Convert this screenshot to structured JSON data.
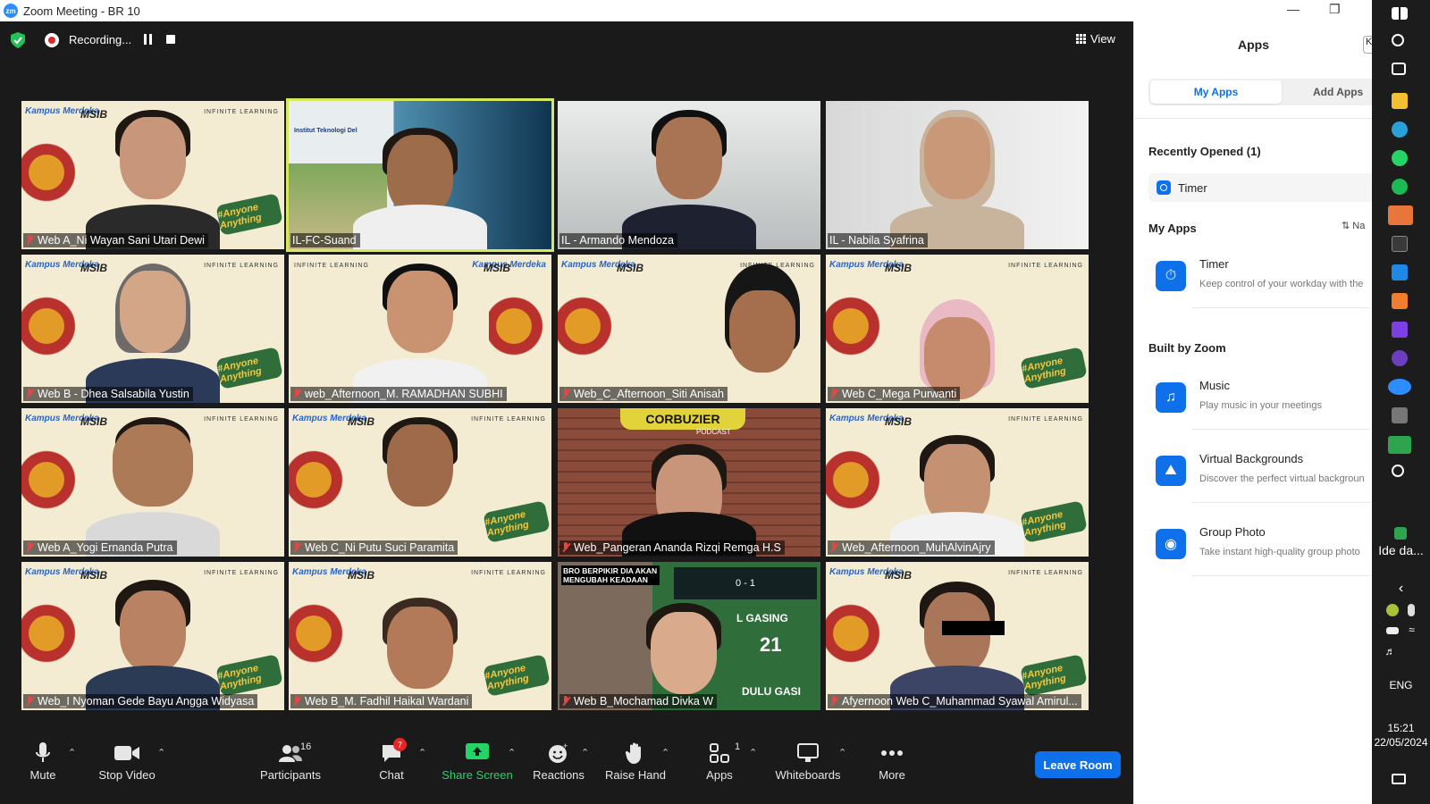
{
  "window": {
    "title": "Zoom Meeting - BR 10",
    "logo_text": "zm"
  },
  "topbar": {
    "recording_label": "Recording...",
    "view_label": "View"
  },
  "tile_branding": {
    "kampus": "Kampus Merdeka",
    "msib": "MSIB",
    "infinite": "INFINITE LEARNING",
    "sticker": "#Anyone Anything"
  },
  "tiles": [
    {
      "name": "Web A_Ni Wayan Sani Utari Dewi"
    },
    {
      "name": "IL-FC-Suand"
    },
    {
      "name": "IL - Armando Mendoza"
    },
    {
      "name": "IL - Nabila Syafrina"
    },
    {
      "name": "Web B - Dhea Salsabila Yustin"
    },
    {
      "name": "web_Afternoon_M. RAMADHAN SUBHI"
    },
    {
      "name": "Web_C_Afternoon_Siti Anisah"
    },
    {
      "name": "Web C_Mega Purwanti"
    },
    {
      "name": "Web A_Yogi Ernanda Putra"
    },
    {
      "name": "Web C_Ni Putu Suci Paramita"
    },
    {
      "name": "Web_Pangeran Ananda Rizqi Remga H.S"
    },
    {
      "name": "Web_Afternoon_MuhAlvinAjry"
    },
    {
      "name": "Web_I Nyoman Gede Bayu Angga Widyasa"
    },
    {
      "name": "Web B_M. Fadhil Haikal Wardani"
    },
    {
      "name": "Web B_Mochamad Divka W"
    },
    {
      "name": "Afyernoon Web C_Muhammad Syawal Amirul..."
    }
  ],
  "slide": {
    "title": "Institut Teknologi Del"
  },
  "overlay": {
    "corbuzier": "CORBUZIER",
    "podcast": "PODCAST",
    "meme": "BRO BERPIKIR DIA AKAN MENGUBAH KEADAAN",
    "gasing": "L GASING",
    "dulu": "DULU GASI",
    "score": "0 - 1",
    "number": "21"
  },
  "toolbar": {
    "mute": "Mute",
    "stop_video": "Stop Video",
    "participants": "Participants",
    "participants_count": "16",
    "chat": "Chat",
    "chat_badge": "7",
    "share_screen": "Share Screen",
    "reactions": "Reactions",
    "raise_hand": "Raise Hand",
    "apps": "Apps",
    "apps_count": "1",
    "whiteboards": "Whiteboards",
    "more": "More",
    "leave": "Leave Room"
  },
  "apps_panel": {
    "title": "Apps",
    "close_label": "K",
    "tab_my": "My Apps",
    "tab_add": "Add Apps",
    "recent_heading": "Recently Opened (1)",
    "recent_item": "Timer",
    "myapps_heading": "My Apps",
    "sort_label": "Na",
    "myapps": [
      {
        "name": "Timer",
        "desc": "Keep control of your workday with the"
      }
    ],
    "built_heading": "Built by Zoom",
    "built": [
      {
        "name": "Music",
        "desc": "Play music in your meetings"
      },
      {
        "name": "Virtual Backgrounds",
        "desc": "Discover the perfect virtual backgroun"
      },
      {
        "name": "Group Photo",
        "desc": "Take instant high-quality group photo"
      }
    ]
  },
  "taskbar": {
    "idle_label": "Ide da...",
    "lang": "ENG",
    "time": "15:21",
    "date": "22/05/2024"
  },
  "colors": {
    "zoom_blue": "#0e71eb",
    "share_green": "#25d366",
    "active_speaker": "#d6e85b",
    "record_red": "#e02828"
  }
}
